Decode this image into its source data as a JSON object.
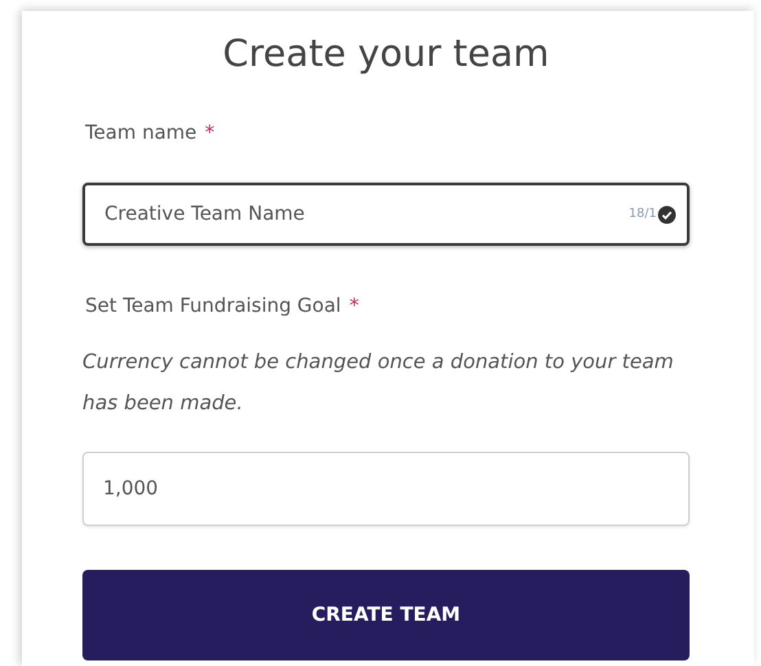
{
  "title": "Create your team",
  "team_name": {
    "label": "Team name",
    "required_mark": "*",
    "value": "Creative Team Name",
    "counter": "18/1",
    "valid": true,
    "focused": true
  },
  "goal": {
    "label": "Set Team Fundraising Goal",
    "required_mark": "*",
    "note": "Currency cannot be changed once a donation to your team has been made.",
    "value": "1,000",
    "focused": false
  },
  "submit_button": "CREATE TEAM"
}
